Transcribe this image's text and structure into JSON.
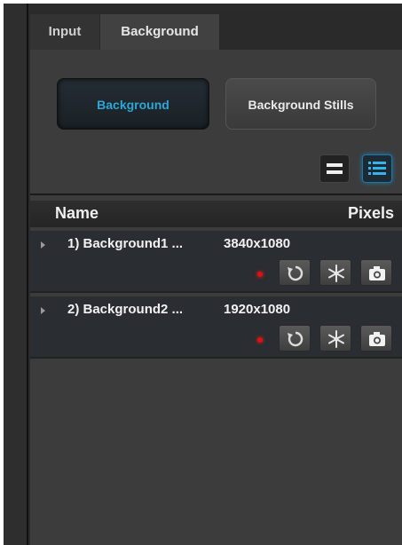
{
  "tabs": [
    {
      "label": "Input"
    },
    {
      "label": "Background"
    }
  ],
  "mode_buttons": {
    "background": "Background",
    "stills": "Background Stills"
  },
  "list": {
    "header": {
      "name": "Name",
      "pixels": "Pixels"
    },
    "rows": [
      {
        "name": "1) Background1 ...",
        "pixels": "3840x1080"
      },
      {
        "name": "2) Background2 ...",
        "pixels": "1920x1080"
      }
    ]
  },
  "colors": {
    "accent": "#2ea6d8",
    "status_dot": "#e01010",
    "panel_bg": "#3c3c3c",
    "row_bg": "#2a2d31"
  },
  "icons": {
    "view_compact": "compact-view-icon",
    "view_list": "list-view-icon",
    "refresh": "refresh-icon",
    "freeze": "freeze-icon",
    "capture": "camera-icon",
    "expand": "expand-arrow-icon",
    "status": "status-dot"
  }
}
